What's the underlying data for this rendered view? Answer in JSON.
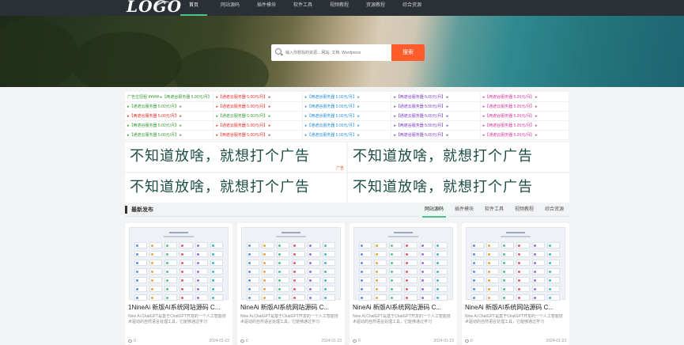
{
  "header": {
    "logo": "LOGO",
    "nav": [
      "首页",
      "网站源码",
      "插件模块",
      "软件工具",
      "视频教程",
      "资源教程",
      "综合资源"
    ],
    "active_nav": 0
  },
  "hero": {
    "search_placeholder": "输入你想找的资源... 网站, 文档, Wordpress",
    "search_button": "搜索"
  },
  "ads": {
    "links": [
      {
        "text": "广告位招租 ¥¥¥¥¥ ▸【两遮谷服务器 5.00元/月】",
        "color": "#3a9b3a"
      },
      {
        "text": "▸【通遮云服务器 5.00元/月】 ▸",
        "color": "#e0312b"
      },
      {
        "text": "▸【两遮谷服务器 5.00元/月】 ▸",
        "color": "#2b8fd6"
      },
      {
        "text": "▸【两遮谷服务器 5.00元/月】 ▸",
        "color": "#7a3fc4"
      },
      {
        "text": "▸【两遮谷服务器 5.00元/月】 ▸",
        "color": "#d23a9b"
      },
      {
        "text": "▸【通遮云服务器 5.00元/月】 ▸",
        "color": "#3a9b3a"
      },
      {
        "text": "▸【通遮云服务器 5.00元/月】 ▸",
        "color": "#e0312b"
      },
      {
        "text": "▸【两遮谷服务器 5.00元/月】 ▸",
        "color": "#2b8fd6"
      },
      {
        "text": "▸【通遮云服务器 5.00元/月】 ▸",
        "color": "#7a3fc4"
      },
      {
        "text": "▸【通遮云服务器 5.00元/月】 ▸",
        "color": "#d23a9b"
      },
      {
        "text": "▸【两遮谷服务器 5.00元/月】 ▸",
        "color": "#e0312b"
      },
      {
        "text": "▸【通遮云服务器 5.00元/月】 ▸",
        "color": "#3a9b3a"
      },
      {
        "text": "▸【两遮谷服务器 5.00元/月】 ▸",
        "color": "#2b8fd6"
      },
      {
        "text": "▸【通遮云服务器 5.00元/月】 ▸",
        "color": "#7a3fc4"
      },
      {
        "text": "▸【两遮谷服务器 5.00元/月】 ▸",
        "color": "#d23a9b"
      },
      {
        "text": "▸【两遮谷服务器 5.00元/月】 ▸",
        "color": "#3a9b3a"
      },
      {
        "text": "▸【通遮云服务器 5.00元/月】 ▸",
        "color": "#e0312b"
      },
      {
        "text": "▸【通遮云服务器 5.00元/月】 ▸",
        "color": "#2b8fd6"
      },
      {
        "text": "▸【两遮谷服务器 5.00元/月】 ▸",
        "color": "#7a3fc4"
      },
      {
        "text": "▸【两遮谷服务器 5.00元/月】 ▸",
        "color": "#d23a9b"
      },
      {
        "text": "▸【通遮云服务器 5.00元/月】 ▸",
        "color": "#3a9b3a"
      },
      {
        "text": "▸【两遮谷服务器 5.00元/月】 ▸",
        "color": "#e0312b"
      },
      {
        "text": "▸【通遮云服务器 5.00元/月】 ▸",
        "color": "#2b8fd6"
      },
      {
        "text": "▸【两遮谷服务器 5.00元/月】 ▸",
        "color": "#7a3fc4"
      },
      {
        "text": "▸【通遮云服务器 5.00元/月】 ▸",
        "color": "#d23a9b"
      }
    ],
    "banners": [
      {
        "text": "不知道放啥，就想打个广告",
        "tag": "广告"
      },
      {
        "text": "不知道放啥，就想打个广告",
        "tag": ""
      },
      {
        "text": "不知道放啥，就想打个广告",
        "tag": ""
      },
      {
        "text": "不知道放啥，就想打个广告",
        "tag": ""
      }
    ]
  },
  "section": {
    "title": "最新发布",
    "tabs": [
      "网站源码",
      "插件模块",
      "软件工具",
      "视频教程",
      "综合资源"
    ],
    "active_tab": 0
  },
  "cards": [
    {
      "title": "1NineAi 新版AI系统网站源码 C...",
      "desc": "Nine Ai.ChatGPT是基于ChatGPT开发的一个人工智能技术驱动的自然语言处理工具，它能够通过学习",
      "views": "0",
      "date": "2024-01-23"
    },
    {
      "title": "NineAi 新版AI系统网站源码 C...",
      "desc": "Nine Ai.ChatGPT是基于ChatGPT开发的一个人工智能技术驱动的自然语言处理工具，它能够通过学习",
      "views": "0",
      "date": "2024-01-23"
    },
    {
      "title": "NineAi 新版AI系统网站源码 C...",
      "desc": "Nine Ai.ChatGPT是基于ChatGPT开发的一个人工智能技术驱动的自然语言处理工具，它能够通过学习",
      "views": "0",
      "date": "2024-01-23"
    },
    {
      "title": "NineAi 新版AI系统网站源码 C...",
      "desc": "Nine Ai.ChatGPT是基于ChatGPT开发的一个人工智能技术驱动的自然语言处理工具，它能够通过学习",
      "views": "0",
      "date": "2024-01-23"
    }
  ],
  "colors": {
    "topbar": "#2b2f36",
    "accent": "#4cc38a",
    "search_button": "#ff5b2b",
    "banner_text": "#1c4d45"
  }
}
